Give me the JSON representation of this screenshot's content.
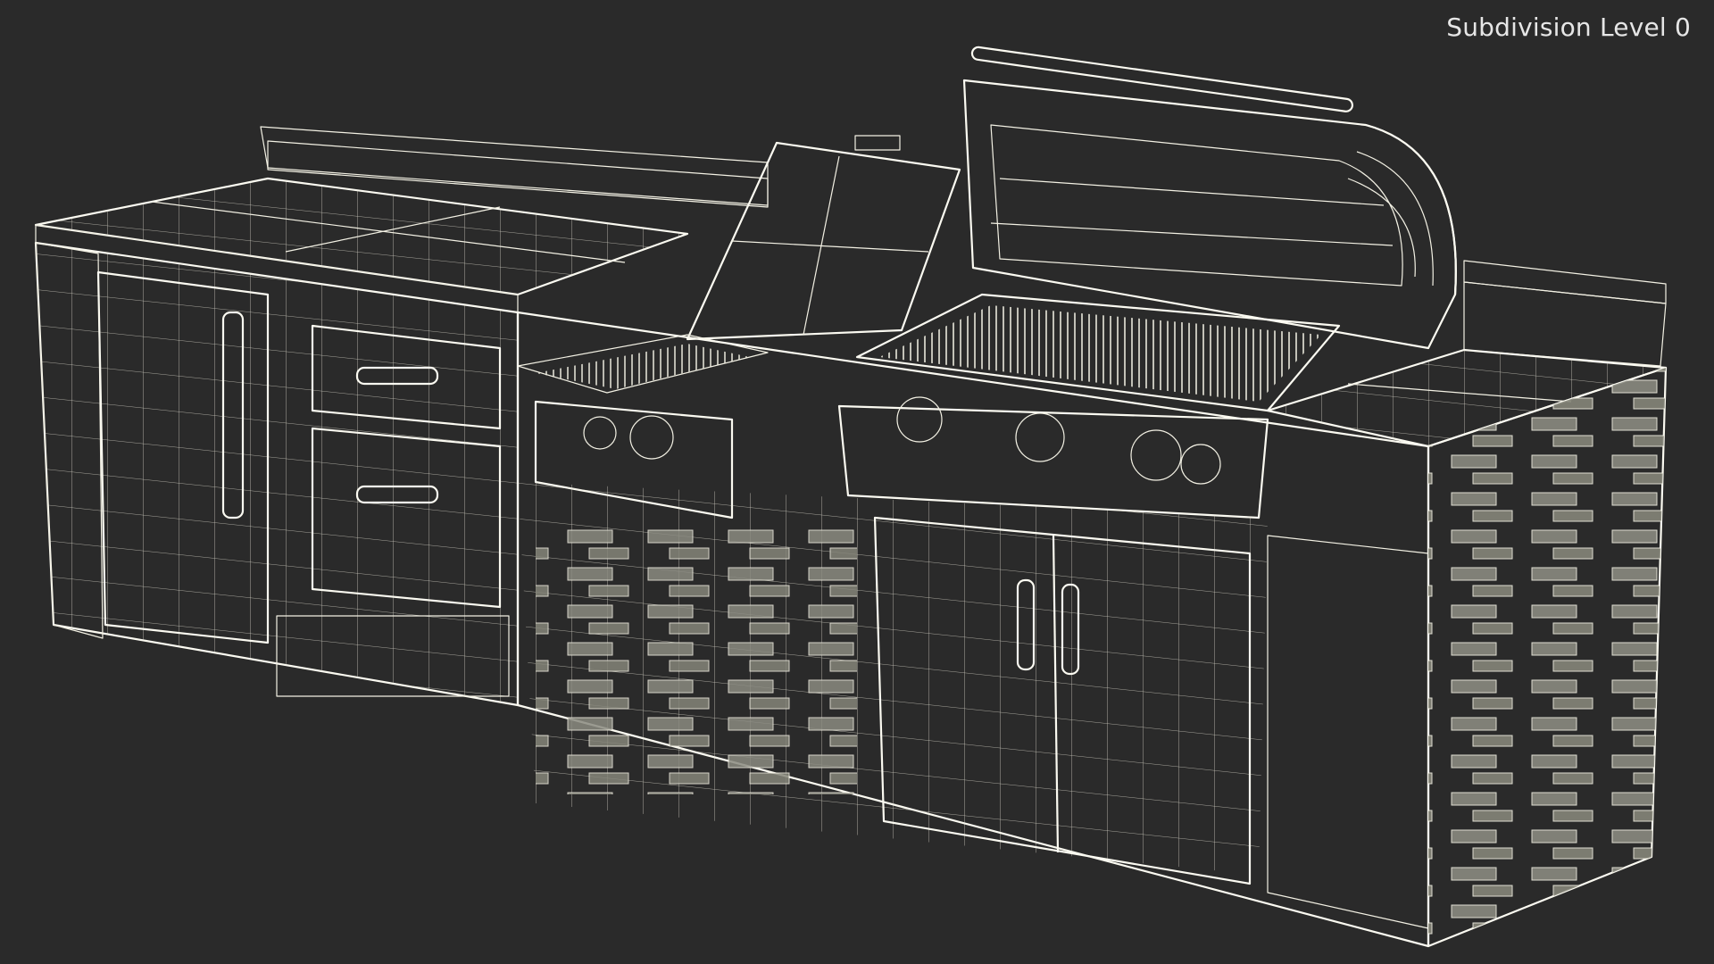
{
  "viewport": {
    "subdivision_label": "Subdivision Level 0"
  },
  "colors": {
    "background": "#2a2a2a",
    "surface": "#7a7a70",
    "surface_dark": "#6b6b62",
    "wire": "#f3f1e4"
  },
  "icons": {
    "render_subject": "outdoor-kitchen-grill-wireframe"
  }
}
